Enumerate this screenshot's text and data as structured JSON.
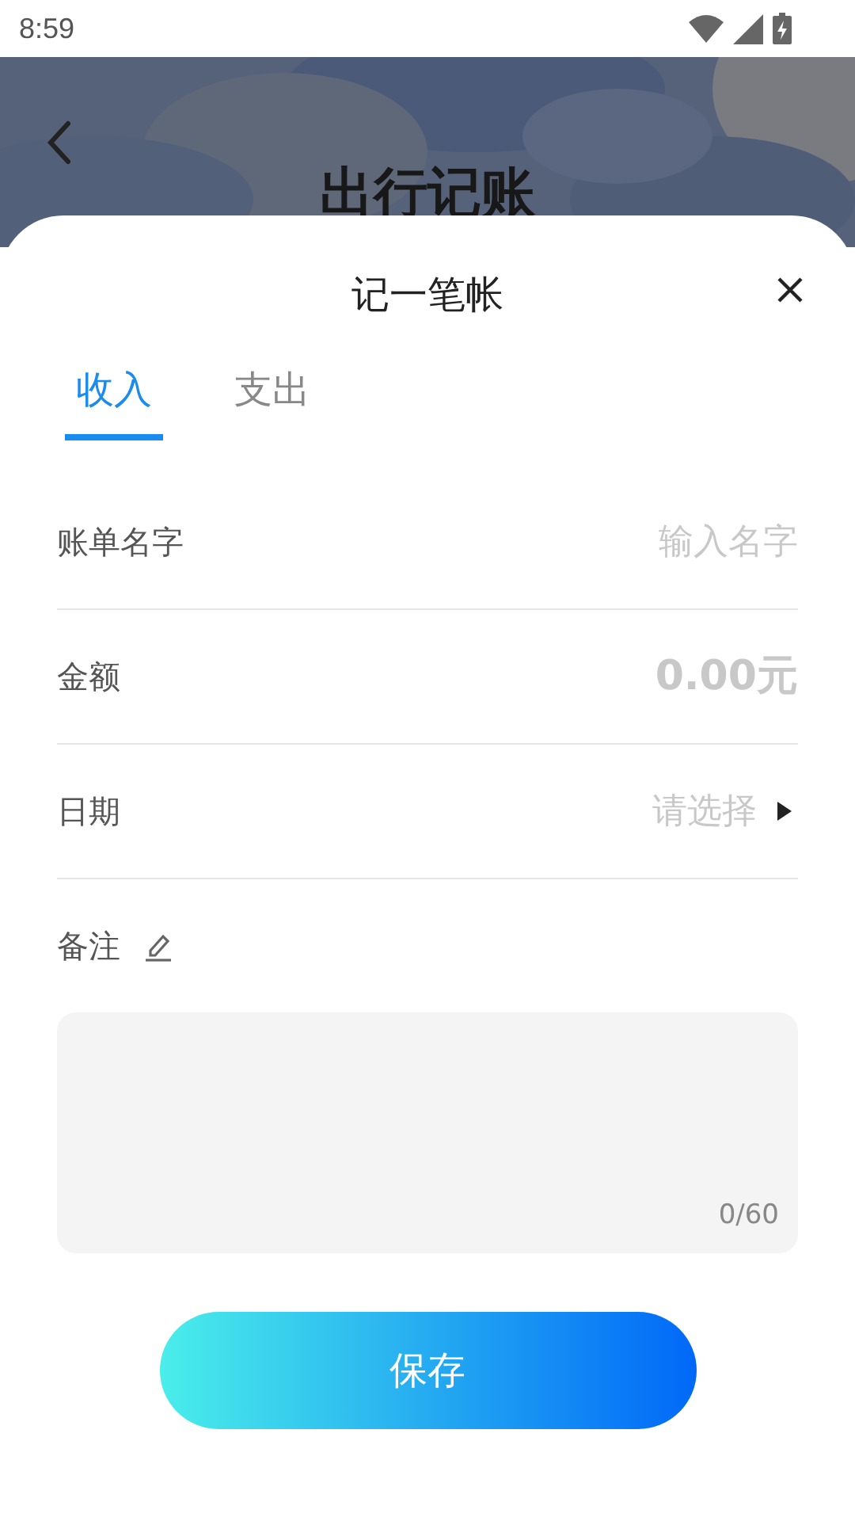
{
  "status_bar": {
    "time": "8:59"
  },
  "header": {
    "title": "出行记账"
  },
  "sheet": {
    "title": "记一笔帐",
    "tabs": [
      {
        "label": "收入",
        "selected": true
      },
      {
        "label": "支出",
        "selected": false
      }
    ],
    "fields": [
      {
        "kind": "text",
        "label": "账单名字",
        "placeholder": "输入名字"
      },
      {
        "kind": "amount",
        "label": "金额",
        "placeholder": "0.00元"
      },
      {
        "kind": "picker",
        "label": "日期",
        "placeholder": "请选择"
      }
    ],
    "note": {
      "label": "备注",
      "counter": "0/60"
    },
    "save_button": "保存"
  }
}
